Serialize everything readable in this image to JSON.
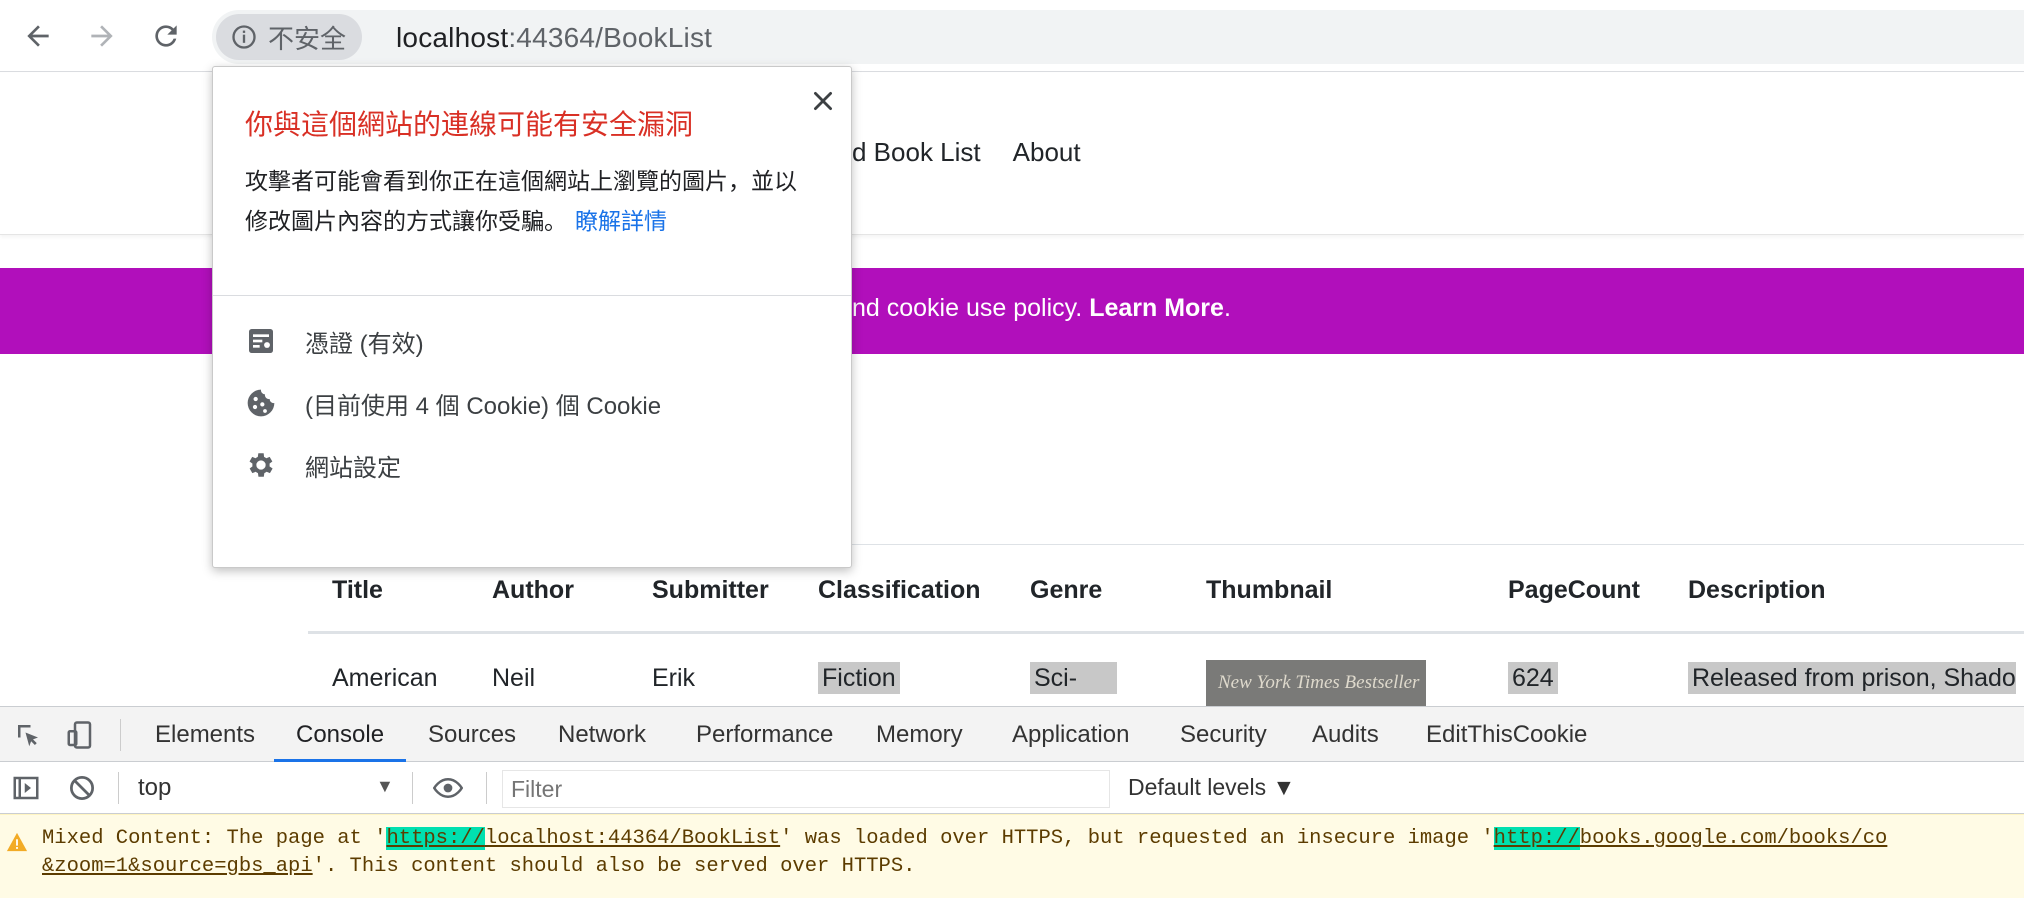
{
  "browser": {
    "security_chip_label": "不安全",
    "url_host": "localhost",
    "url_rest": ":44364/BookList"
  },
  "site": {
    "nav": [
      "d Book List",
      "About"
    ],
    "cookie_text": "nd cookie use policy.",
    "cookie_link": "Learn More",
    "cookie_tail": ".",
    "cookie_color": "#b10fbb"
  },
  "table": {
    "headers": [
      "Title",
      "Author",
      "Submitter",
      "Classification",
      "Genre",
      "Thumbnail",
      "PageCount",
      "Description"
    ],
    "row": {
      "title": "American",
      "author": "Neil",
      "submitter": "Erik",
      "classification": "Fiction",
      "genre": "Sci-",
      "thumbnail_text": "New York Times Bestseller",
      "pagecount": "624",
      "description": "Released from prison, Shado"
    }
  },
  "popup": {
    "title": "你與這個網站的連線可能有安全漏洞",
    "body_line1": "攻擊者可能會看到你正在這個網站上瀏覽的圖片，並以",
    "body_line2": "修改圖片內容的方式讓你受騙。",
    "learn_more": "瞭解詳情",
    "items": [
      {
        "icon": "certificate-icon",
        "label": "憑證 (有效)"
      },
      {
        "icon": "cookie-icon",
        "label": "(目前使用 4 個 Cookie) 個 Cookie"
      },
      {
        "icon": "gear-icon",
        "label": "網站設定"
      }
    ],
    "title_color": "#d93025"
  },
  "devtools": {
    "tabs": [
      "Elements",
      "Console",
      "Sources",
      "Network",
      "Performance",
      "Memory",
      "Application",
      "Security",
      "Audits",
      "EditThisCookie"
    ],
    "active_tab": "Console",
    "context": "top",
    "filter_placeholder": "Filter",
    "levels": "Default levels ▼",
    "warning": {
      "part1": "Mixed Content: The page at '",
      "url1_scheme": "https://",
      "url1_rest": "localhost:44364/BookList",
      "part2": "' was loaded over HTTPS, but requested an insecure image '",
      "url2_scheme": "http://",
      "url2_rest": "books.google.com/books/co",
      "line2_link": "&zoom=1&source=gbs_api",
      "line2_rest": "'. This content should also be served over HTTPS."
    }
  }
}
